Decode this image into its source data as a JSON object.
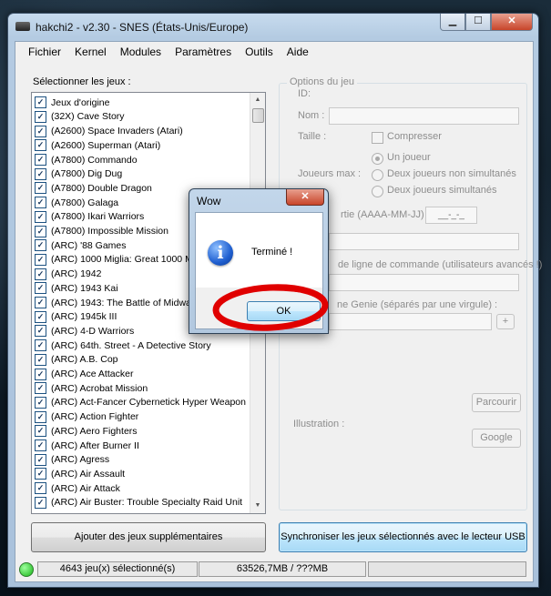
{
  "window": {
    "title": "hakchi2 - v2.30 - SNES (États-Unis/Europe)",
    "caption_min": "▁",
    "caption_max": "☐",
    "caption_close": "✕"
  },
  "menu": [
    "Fichier",
    "Kernel",
    "Modules",
    "Paramètres",
    "Outils",
    "Aide"
  ],
  "games": {
    "label": "Sélectionner les jeux :",
    "items": [
      "Jeux d'origine",
      "(32X) Cave Story",
      "(A2600) Space Invaders (Atari)",
      "(A2600) Superman (Atari)",
      "(A7800) Commando",
      "(A7800) Dig Dug",
      "(A7800) Double Dragon",
      "(A7800) Galaga",
      "(A7800) Ikari Warriors",
      "(A7800) Impossible Mission",
      "(ARC) '88 Games",
      "(ARC) 1000 Miglia: Great 1000 Miles",
      "(ARC) 1942",
      "(ARC) 1943 Kai",
      "(ARC) 1943: The Battle of Midway M",
      "(ARC) 1945k III",
      "(ARC) 4-D Warriors",
      "(ARC) 64th. Street - A Detective Story",
      "(ARC) A.B. Cop",
      "(ARC) Ace Attacker",
      "(ARC) Acrobat Mission",
      "(ARC) Act-Fancer Cybernetick Hyper Weapon",
      "(ARC) Action Fighter",
      "(ARC) Aero Fighters",
      "(ARC) After Burner II",
      "(ARC) Agress",
      "(ARC) Air Assault",
      "(ARC) Air Attack",
      "(ARC) Air Buster: Trouble Specialty Raid Unit"
    ],
    "check_mark": "✓"
  },
  "options": {
    "group_title": "Options du jeu",
    "id_label": "ID:",
    "name_label": "Nom :",
    "size_label": "Taille :",
    "compress_label": "Compresser",
    "max_players_label": "Joueurs max :",
    "radio_one": "Un joueur",
    "radio_two_non_sim": "Deux joueurs non simultanés",
    "radio_two_sim": "Deux joueurs simultanés",
    "date_label": "rtie (AAAA-MM-JJ) :",
    "date_value": "__-_-_",
    "cmdline_label": "de ligne de commande (utilisateurs avancés !)",
    "genie_label": "ne Genie (séparés par une virgule) :",
    "plus": "+",
    "browse": "Parcourir",
    "illustration_label": "Illustration :",
    "google": "Google"
  },
  "buttons": {
    "add_games": "Ajouter des jeux supplémentaires",
    "sync": "Synchroniser les jeux sélectionnés avec le lecteur USB"
  },
  "status": {
    "selected": "4643 jeu(x) sélectionné(s)",
    "size": "63526,7MB / ???MB"
  },
  "dialog": {
    "title": "Wow",
    "close": "✕",
    "icon": "i",
    "message": "Terminé !",
    "ok": "OK",
    "highlight_color": "#e00000"
  }
}
